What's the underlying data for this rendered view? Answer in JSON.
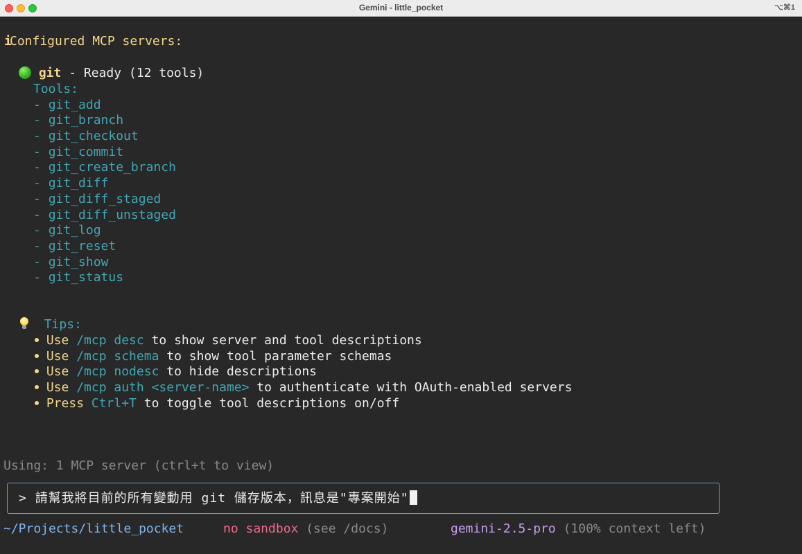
{
  "window": {
    "title": "Gemini - little_pocket",
    "shortcut": "⌥⌘1"
  },
  "header": {
    "info_icon": "i",
    "text": "Configured MCP servers:"
  },
  "server": {
    "status_icon": "green-circle",
    "name": "git",
    "status": " - Ready (12 tools)",
    "tools_label": "Tools:",
    "dash": "- ",
    "tools": [
      "git_add",
      "git_branch",
      "git_checkout",
      "git_commit",
      "git_create_branch",
      "git_diff",
      "git_diff_staged",
      "git_diff_unstaged",
      "git_log",
      "git_reset",
      "git_show",
      "git_status"
    ]
  },
  "tips": {
    "icon": "lightbulb",
    "label": "Tips:",
    "items": [
      {
        "lead": "Use ",
        "cmd": "/mcp desc",
        "rest": " to show server and tool descriptions"
      },
      {
        "lead": "Use ",
        "cmd": "/mcp schema",
        "rest": " to show tool parameter schemas"
      },
      {
        "lead": "Use ",
        "cmd": "/mcp nodesc",
        "rest": " to hide descriptions"
      },
      {
        "lead": "Use ",
        "cmd": "/mcp auth <server-name>",
        "rest": " to authenticate with OAuth-enabled servers"
      },
      {
        "lead": "Press ",
        "cmd": "Ctrl+T",
        "rest": " to toggle tool descriptions on/off"
      }
    ]
  },
  "usage": "Using: 1 MCP server (ctrl+t to view)",
  "prompt": {
    "symbol": ">",
    "value": "請幫我將目前的所有變動用 git 儲存版本，訊息是\"專案開始\""
  },
  "footer": {
    "path": "~/Projects/little_pocket",
    "sandbox": "no sandbox",
    "sandbox_hint": "(see /docs)",
    "model": "gemini-2.5-pro",
    "context": "(100% context left)"
  },
  "colors": {
    "background": "#282828",
    "yellow": "#f4d58d",
    "teal": "#41a6b5",
    "blue": "#7fb6f0",
    "pink": "#f26a8d",
    "purple": "#c79ff2",
    "input_border": "#6b9bd1"
  }
}
